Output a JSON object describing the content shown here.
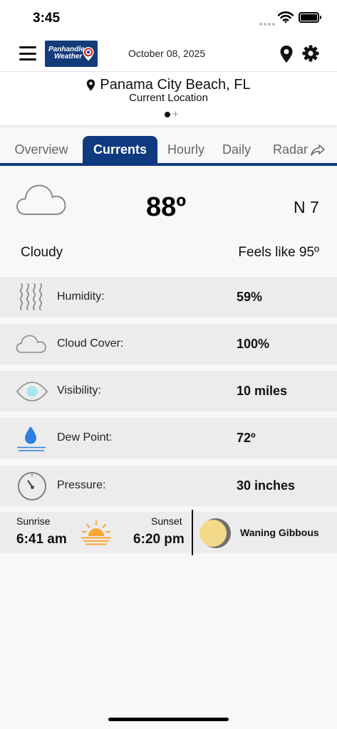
{
  "status": {
    "time": "3:45"
  },
  "header": {
    "logo_line1": "Panhandle",
    "logo_line2": "Weather",
    "date": "October 08, 2025"
  },
  "location": {
    "name": "Panama City Beach, FL",
    "subtitle": "Current Location",
    "pager_add": "+"
  },
  "tabs": [
    {
      "label": "Overview",
      "active": false
    },
    {
      "label": "Currents",
      "active": true
    },
    {
      "label": "Hourly",
      "active": false
    },
    {
      "label": "Daily",
      "active": false
    },
    {
      "label": "Radar",
      "active": false
    }
  ],
  "current": {
    "temperature": "88º",
    "wind": "N 7",
    "condition": "Cloudy",
    "feels_like": "Feels like 95º"
  },
  "details": [
    {
      "icon": "humidity-icon",
      "label": "Humidity:",
      "value": "59%"
    },
    {
      "icon": "cloud-cover-icon",
      "label": "Cloud Cover:",
      "value": "100%"
    },
    {
      "icon": "visibility-eye-icon",
      "label": "Visibility:",
      "value": "10 miles"
    },
    {
      "icon": "dew-point-drop-icon",
      "label": "Dew Point:",
      "value": "72º"
    },
    {
      "icon": "pressure-gauge-icon",
      "label": "Pressure:",
      "value": "30 inches"
    }
  ],
  "sun": {
    "sunrise_label": "Sunrise",
    "sunrise_time": "6:41 am",
    "sunset_label": "Sunset",
    "sunset_time": "6:20 pm"
  },
  "moon": {
    "phase": "Waning Gibbous"
  },
  "colors": {
    "brand_navy": "#0f3a7f",
    "sun_orange": "#f7a533",
    "moon_yellow": "#f3d98a",
    "drop_blue": "#2f7fe0"
  }
}
